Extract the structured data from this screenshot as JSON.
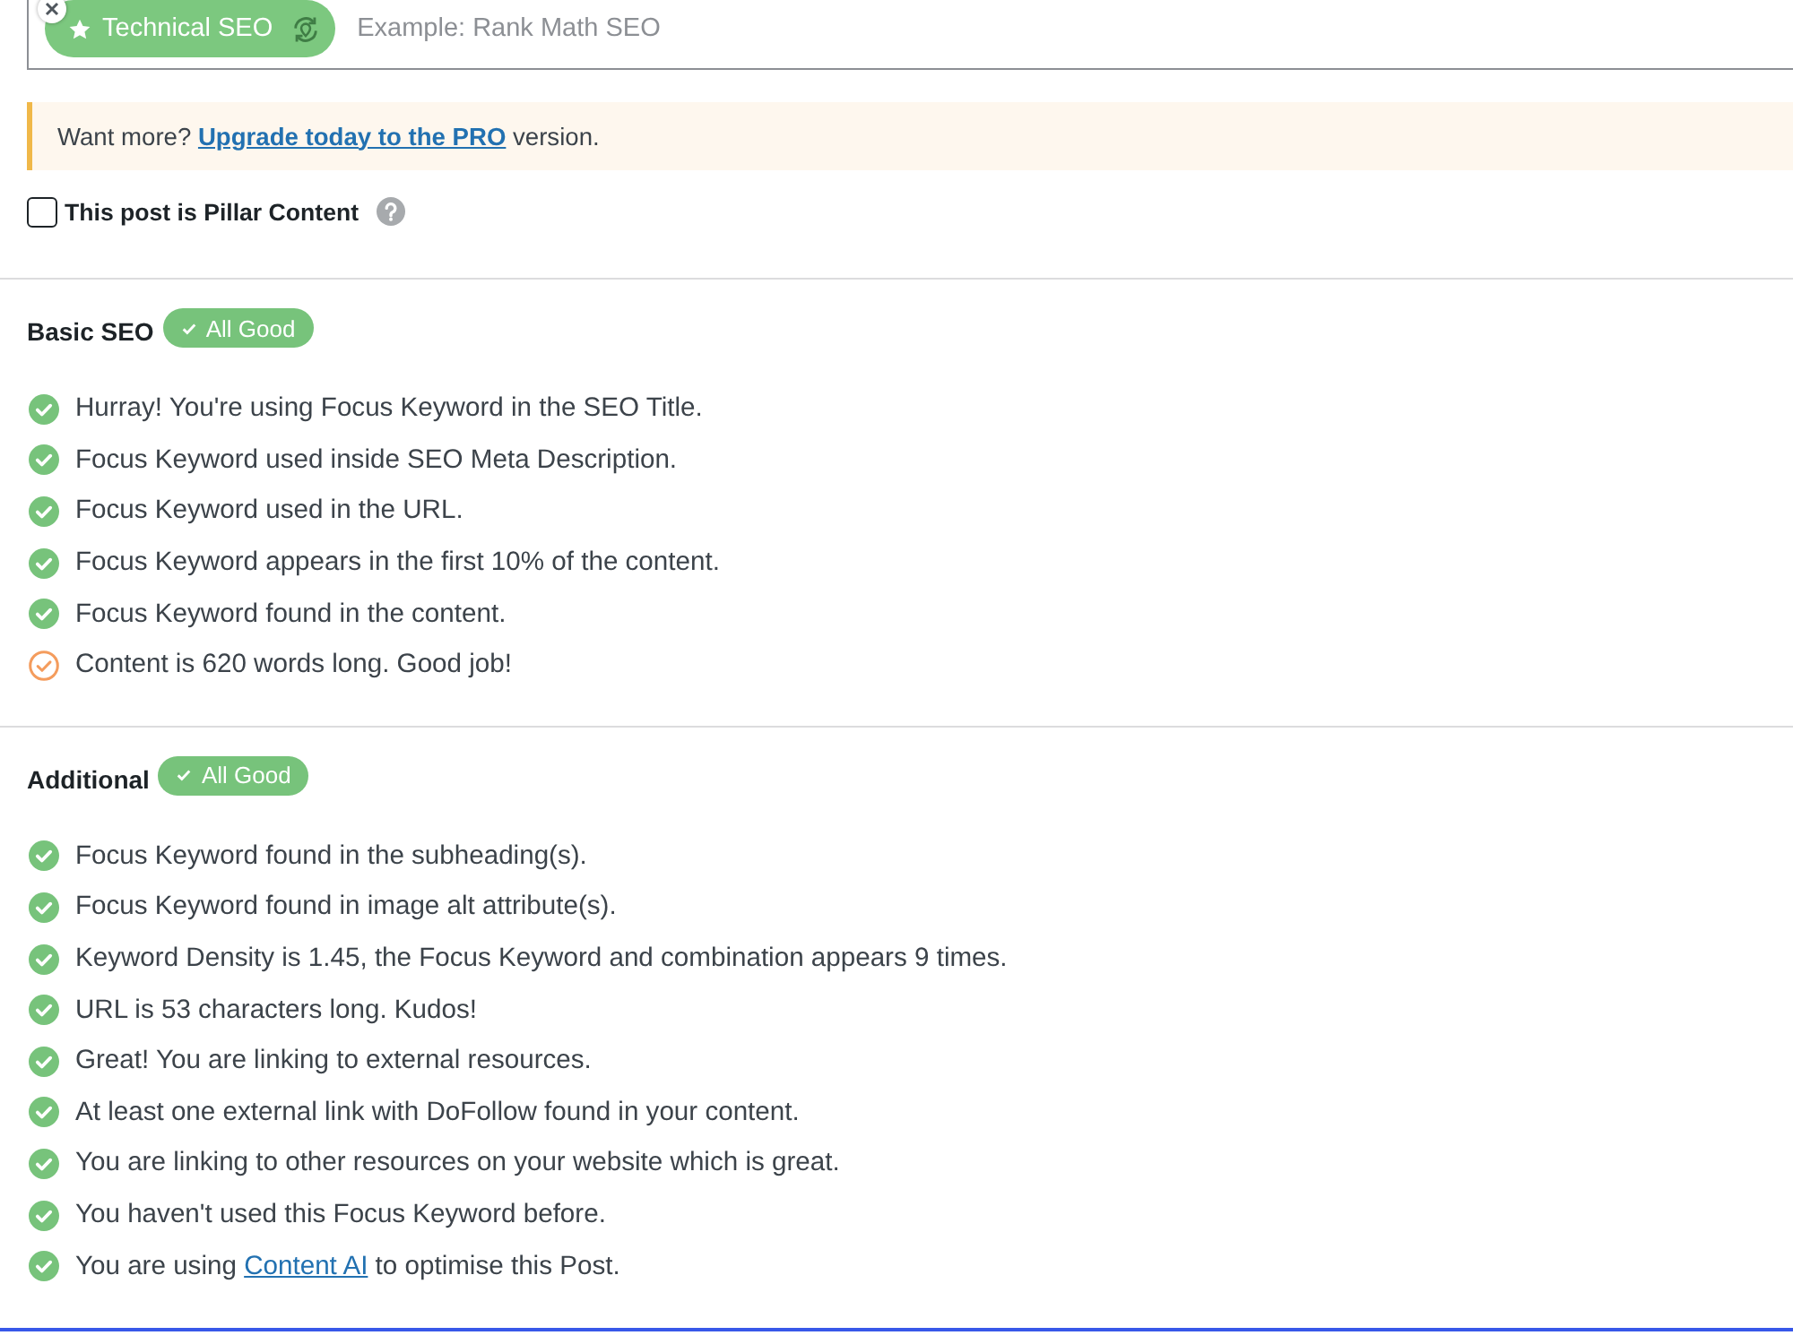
{
  "focus_keyword": {
    "tags": [
      {
        "label": "Technical SEO",
        "primary": true
      }
    ],
    "placeholder": "Example: Rank Math SEO"
  },
  "notice": {
    "text": "Want more?",
    "link": "Upgrade today to the PRO",
    "after": "version."
  },
  "pillar_content": {
    "label": "This post is Pillar Content",
    "checked": false
  },
  "sections": [
    {
      "title": "Basic SEO",
      "badge": "All Good",
      "items": [
        {
          "text": "Hurray! You're using Focus Keyword in the SEO Title.",
          "kind": "pass"
        },
        {
          "text": "Focus Keyword used inside SEO Meta Description.",
          "kind": "pass"
        },
        {
          "text": "Focus Keyword used in the URL.",
          "kind": "pass"
        },
        {
          "text": "Focus Keyword appears in the first 10% of the content.",
          "kind": "pass"
        },
        {
          "text": "Focus Keyword found in the content.",
          "kind": "pass"
        },
        {
          "text": "Content is 620 words long. Good job!",
          "kind": "warning"
        }
      ]
    },
    {
      "title": "Additional",
      "badge": "All Good",
      "items": [
        {
          "text": "Focus Keyword found in the subheading(s).",
          "kind": "pass"
        },
        {
          "text": "Focus Keyword found in image alt attribute(s).",
          "kind": "pass"
        },
        {
          "text": "Keyword Density is 1.45, the Focus Keyword and combination appears 9 times.",
          "kind": "pass"
        },
        {
          "text": "URL is 53 characters long. Kudos!",
          "kind": "pass"
        },
        {
          "text": "Great! You are linking to external resources.",
          "kind": "pass"
        },
        {
          "text": "At least one external link with DoFollow found in your content.",
          "kind": "pass"
        },
        {
          "text": "You are linking to other resources on your website which is great.",
          "kind": "pass"
        },
        {
          "text": "You haven't used this Focus Keyword before.",
          "kind": "pass"
        },
        {
          "text": "You are using",
          "link": "Content AI",
          "after": "to optimise this Post.",
          "kind": "pass"
        }
      ]
    }
  ]
}
